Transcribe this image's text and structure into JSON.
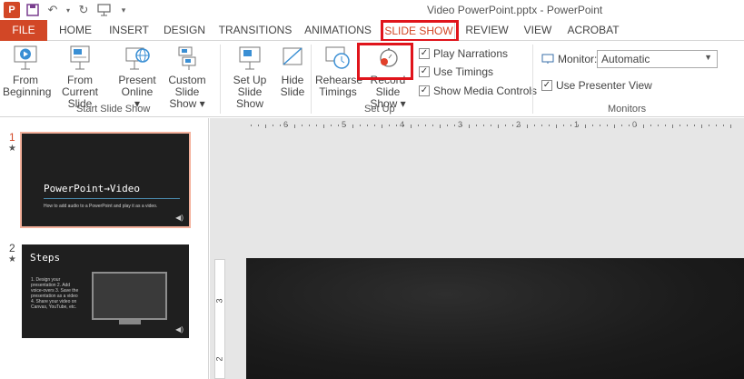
{
  "window": {
    "title": "Video PowerPoint.pptx - PowerPoint"
  },
  "qat": {
    "logo_letter": "P"
  },
  "tabs": [
    {
      "label": "FILE"
    },
    {
      "label": "HOME"
    },
    {
      "label": "INSERT"
    },
    {
      "label": "DESIGN"
    },
    {
      "label": "TRANSITIONS"
    },
    {
      "label": "ANIMATIONS"
    },
    {
      "label": "SLIDE SHOW"
    },
    {
      "label": "REVIEW"
    },
    {
      "label": "VIEW"
    },
    {
      "label": "ACROBAT"
    }
  ],
  "ribbon": {
    "start": {
      "label": "Start Slide Show",
      "from_beginning": [
        "From",
        "Beginning"
      ],
      "from_current": [
        "From",
        "Current Slide"
      ],
      "present_online": [
        "Present",
        "Online ▾"
      ],
      "custom_show": [
        "Custom Slide",
        "Show ▾"
      ]
    },
    "setup": {
      "label": "Set Up",
      "setup_show": [
        "Set Up",
        "Slide Show"
      ],
      "hide_slide": [
        "Hide",
        "Slide"
      ],
      "rehearse": [
        "Rehearse",
        "Timings"
      ],
      "record": [
        "Record Slide",
        "Show ▾"
      ],
      "play_narrations": "Play Narrations",
      "use_timings": "Use Timings",
      "show_media_controls": "Show Media Controls"
    },
    "monitors": {
      "label": "Monitors",
      "monitor_label": "Monitor:",
      "monitor_value": "Automatic",
      "use_presenter_view": "Use Presenter View"
    }
  },
  "thumbnails": [
    {
      "number": "1",
      "title": "PowerPoint→Video",
      "subtitle": "How to add audio to a PowerPoint and play it as a video."
    },
    {
      "number": "2",
      "title": "Steps",
      "bullets": "1. Design your presentation 2. Add voice-overs 3. Save the presentation as a video 4. Share your video on Canvas, YouTube, etc."
    }
  ],
  "rulers": {
    "h_ticks": [
      "6",
      "5",
      "4",
      "3",
      "2",
      "1",
      "0"
    ],
    "v_ticks": [
      "3",
      "2"
    ]
  },
  "colors": {
    "accent": "#d24726",
    "highlight": "#e0141b"
  }
}
